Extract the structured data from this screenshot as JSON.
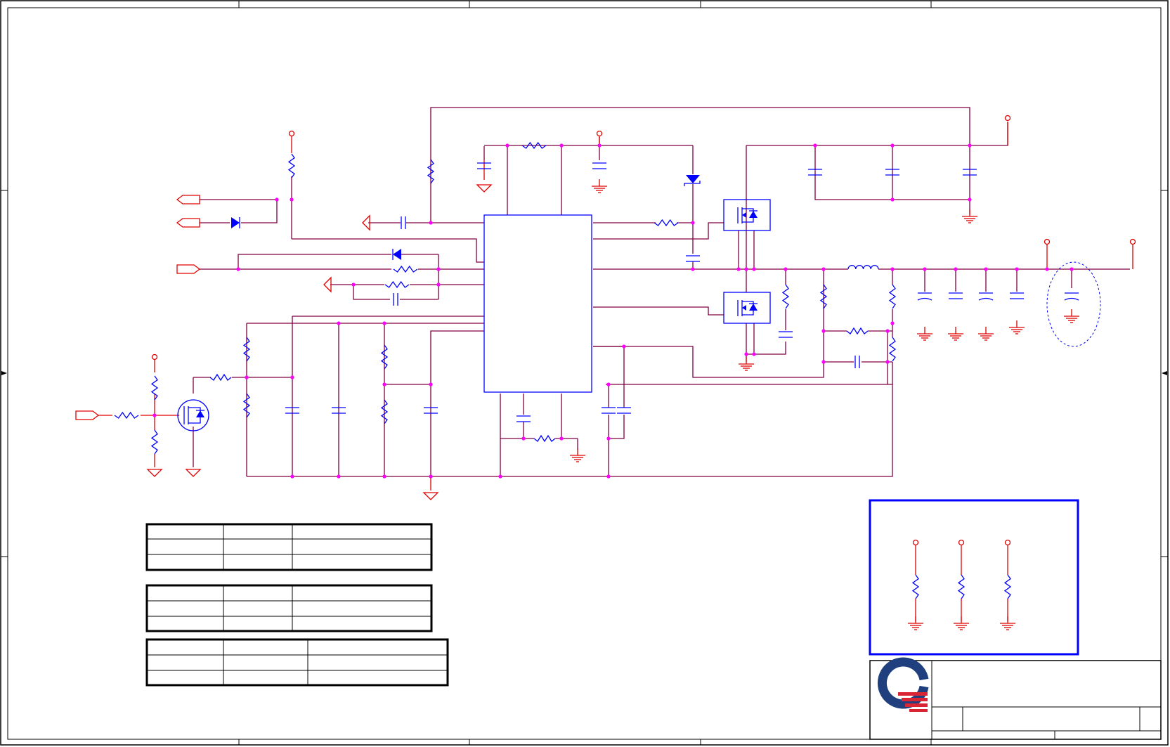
{
  "sheet": {
    "background": "#ffffff",
    "wire_color": "#800040",
    "pin_color": "#e00000",
    "component_color": "#0000ff",
    "junction_color": "#ff00ff",
    "title_block_highlight": "#0000ff"
  },
  "logo": {
    "name": "quanta-logo",
    "ring_color": "#1f3f7f",
    "stripe_color": "#d92534"
  },
  "icons": [
    "resistor-icon",
    "capacitor-icon",
    "inductor-icon",
    "diode-icon",
    "mosfet-icon",
    "ground-icon",
    "power-pin-icon",
    "port-arrow-icon",
    "regulator-ic-icon"
  ]
}
